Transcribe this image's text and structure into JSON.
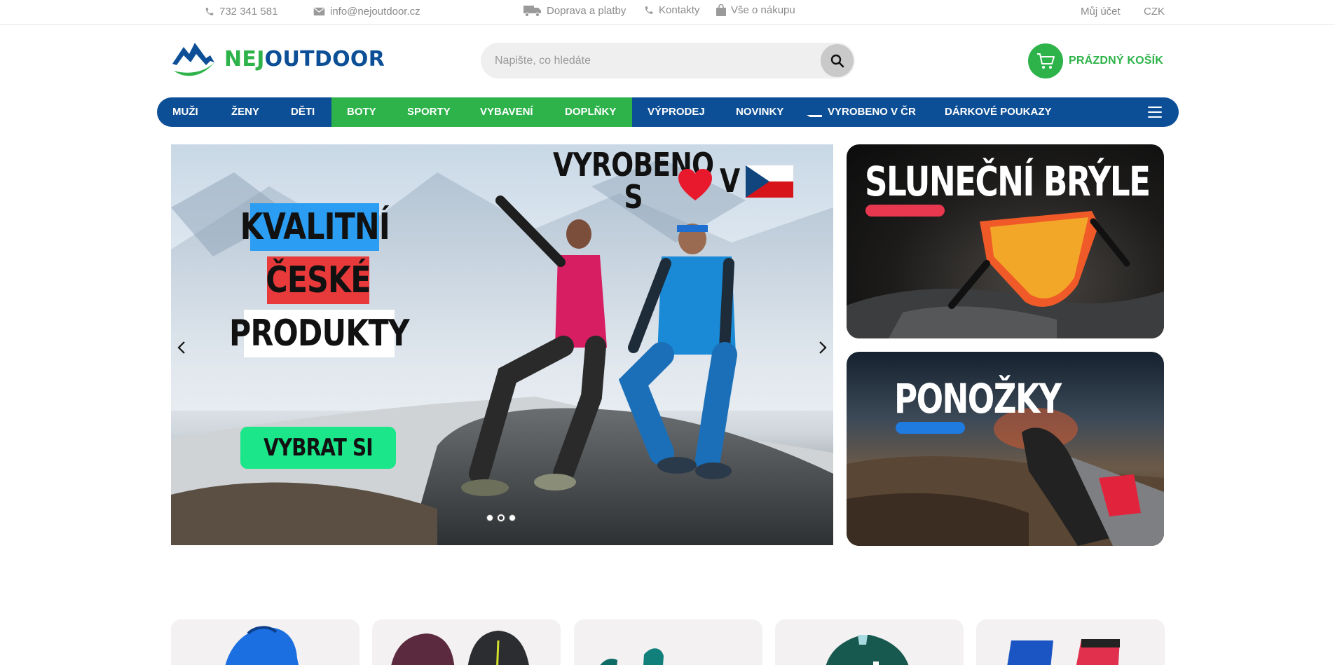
{
  "topbar": {
    "phone": "732 341 581",
    "email": "info@nejoutdoor.cz",
    "shipping": "Doprava a platby",
    "contacts": "Kontakty",
    "shopping_info": "Vše o nákupu",
    "account": "Můj účet",
    "currency": "CZK"
  },
  "header": {
    "logo_nej": "NEJ",
    "logo_outdoor": "OUTDOOR",
    "search_placeholder": "Napište, co hledáte",
    "cart_label": "PRÁZDNÝ KOŠÍK"
  },
  "nav": {
    "items": [
      {
        "label": "MUŽI"
      },
      {
        "label": "ŽENY"
      },
      {
        "label": "DĚTI"
      },
      {
        "label": "BOTY"
      },
      {
        "label": "SPORTY"
      },
      {
        "label": "VYBAVENÍ"
      },
      {
        "label": "DOPLŇKY"
      },
      {
        "label": "VÝPRODEJ"
      },
      {
        "label": "NOVINKY"
      },
      {
        "label": "VYROBENO V ČR"
      },
      {
        "label": "DÁRKOVÉ POUKAZY"
      }
    ]
  },
  "hero": {
    "top_text_1": "VYROBENO S",
    "top_text_2": "V",
    "line1": "KVALITNÍ",
    "line2": "ČESKÉ",
    "line3": "PRODUKTY",
    "cta": "VYBRAT SI",
    "slide_count": 3,
    "active_slide": 2
  },
  "promos": [
    {
      "title": "SLUNEČNÍ BRÝLE",
      "bar_color": "#e8384f"
    },
    {
      "title": "PONOŽKY",
      "bar_color": "#1f7be0"
    }
  ],
  "colors": {
    "brand_green": "#2db34a",
    "brand_blue": "#0d4f96",
    "cta_green": "#1ce68a"
  }
}
